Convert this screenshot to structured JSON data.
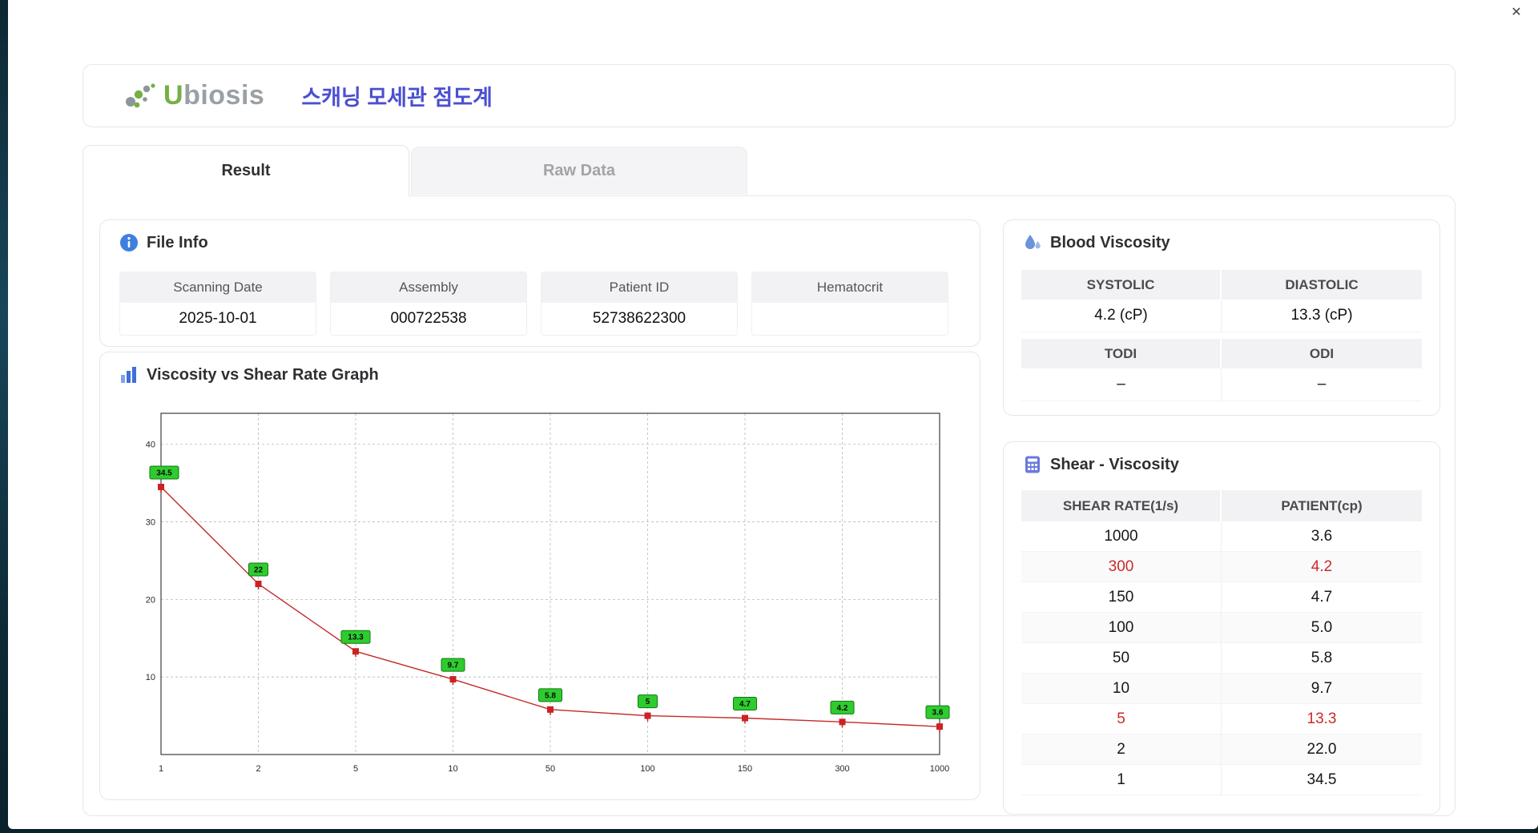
{
  "window": {
    "close_label": "✕"
  },
  "header": {
    "logo_u": "U",
    "logo_rest": "biosis",
    "title": "스캐닝 모세관 점도계"
  },
  "tabs": [
    {
      "label": "Result",
      "active": true
    },
    {
      "label": "Raw Data",
      "active": false
    }
  ],
  "file_info": {
    "title": "File Info",
    "fields": [
      {
        "label": "Scanning Date",
        "value": "2025-10-01"
      },
      {
        "label": "Assembly",
        "value": "000722538"
      },
      {
        "label": "Patient ID",
        "value": "52738622300"
      },
      {
        "label": "Hematocrit",
        "value": ""
      }
    ]
  },
  "graph_card": {
    "title": "Viscosity vs Shear Rate Graph"
  },
  "chart_data": {
    "type": "line",
    "title": "Viscosity vs Shear Rate Graph",
    "categories": [
      "1",
      "2",
      "5",
      "10",
      "50",
      "100",
      "150",
      "300",
      "1000"
    ],
    "values": [
      34.5,
      22,
      13.3,
      9.7,
      5.8,
      5,
      4.7,
      4.2,
      3.6
    ],
    "point_labels": [
      "34.5",
      "22",
      "13.3",
      "9.7",
      "5.8",
      "5",
      "4.7",
      "4.2",
      "3.6"
    ],
    "yticks": [
      10,
      20,
      30,
      40
    ],
    "ylim": [
      0,
      44
    ],
    "xlabel": "",
    "ylabel": "",
    "grid": true,
    "legend": "none",
    "line_color": "#c42a2a",
    "marker_color": "#cc2222",
    "label_bg": "#2ecc2e",
    "label_border": "#117711"
  },
  "blood_viscosity": {
    "title": "Blood Viscosity",
    "cells": [
      {
        "label": "SYSTOLIC",
        "value": "4.2 (cP)"
      },
      {
        "label": "DIASTOLIC",
        "value": "13.3 (cP)"
      },
      {
        "label": "TODI",
        "value": "–"
      },
      {
        "label": "ODI",
        "value": "–"
      }
    ]
  },
  "shear_table": {
    "title": "Shear - Viscosity",
    "columns": [
      "SHEAR RATE(1/s)",
      "PATIENT(cp)"
    ],
    "rows": [
      {
        "shear": "1000",
        "patient": "3.6",
        "highlight": false
      },
      {
        "shear": "300",
        "patient": "4.2",
        "highlight": true
      },
      {
        "shear": "150",
        "patient": "4.7",
        "highlight": false
      },
      {
        "shear": "100",
        "patient": "5.0",
        "highlight": false
      },
      {
        "shear": "50",
        "patient": "5.8",
        "highlight": false
      },
      {
        "shear": "10",
        "patient": "9.7",
        "highlight": false
      },
      {
        "shear": "5",
        "patient": "13.3",
        "highlight": true
      },
      {
        "shear": "2",
        "patient": "22.0",
        "highlight": false
      },
      {
        "shear": "1",
        "patient": "34.5",
        "highlight": false
      }
    ]
  }
}
